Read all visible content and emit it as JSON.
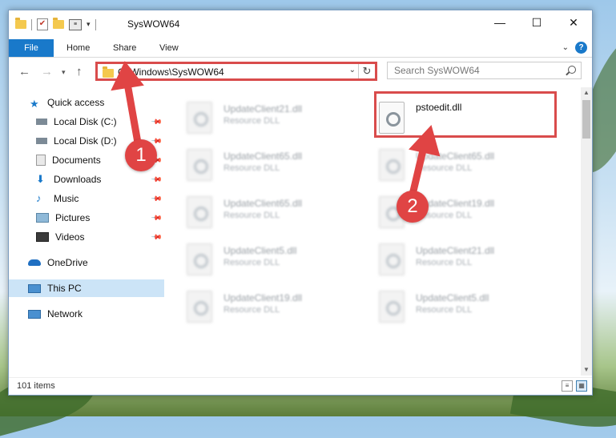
{
  "window": {
    "title": "SysWOW64",
    "controls": {
      "minimize": "—",
      "maximize": "☐",
      "close": "✕"
    }
  },
  "ribbon": {
    "file_tab": "File",
    "tabs": [
      "Home",
      "Share",
      "View"
    ],
    "help": "?"
  },
  "address_bar": {
    "path": "C:\\Windows\\SysWOW64",
    "search_placeholder": "Search SysWOW64"
  },
  "sidebar": {
    "quick_access": "Quick access",
    "pinned": [
      "Local Disk (C:)",
      "Local Disk (D:)",
      "Documents",
      "Downloads",
      "Music",
      "Pictures",
      "Videos"
    ],
    "onedrive": "OneDrive",
    "this_pc": "This PC",
    "network": "Network"
  },
  "files": {
    "col1": [
      {
        "name": "UpdateClient21.dll",
        "type": "Resource DLL"
      },
      {
        "name": "UpdateClient65.dll",
        "type": "Resource DLL"
      },
      {
        "name": "UpdateClient65.dll",
        "type": "Resource DLL"
      },
      {
        "name": "UpdateClient5.dll",
        "type": "Resource DLL"
      },
      {
        "name": "UpdateClient19.dll",
        "type": "Resource DLL"
      }
    ],
    "col2": [
      {
        "name": "pstoedit.dll",
        "type": ""
      },
      {
        "name": "UpdateClient65.dll",
        "type": "Resource DLL"
      },
      {
        "name": "UpdateClient19.dll",
        "type": "Resource DLL"
      },
      {
        "name": "UpdateClient21.dll",
        "type": "Resource DLL"
      },
      {
        "name": "UpdateClient5.dll",
        "type": "Resource DLL"
      }
    ]
  },
  "status": {
    "item_count": "101 items"
  },
  "annotations": {
    "step1": "1",
    "step2": "2",
    "color": "#e04444"
  }
}
